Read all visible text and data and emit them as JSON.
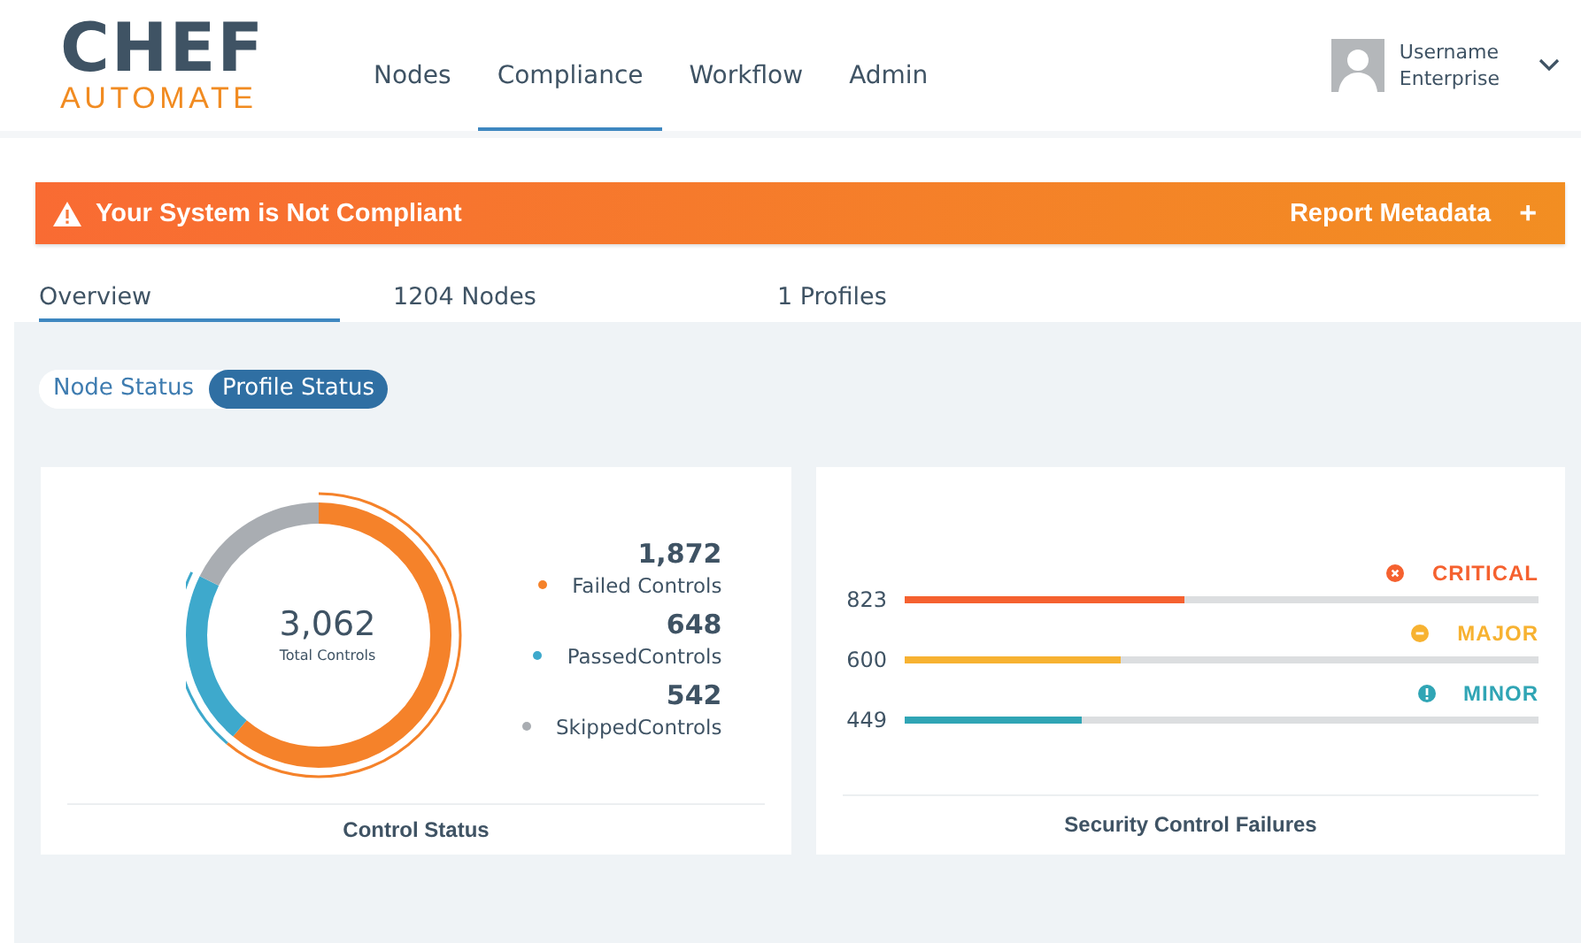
{
  "header": {
    "logo_top": "CHEF",
    "logo_bottom": "AUTOMATE",
    "nav": [
      {
        "label": "Nodes",
        "selected": false
      },
      {
        "label": "Compliance",
        "selected": true
      },
      {
        "label": "Workflow",
        "selected": false
      },
      {
        "label": "Admin",
        "selected": false
      }
    ],
    "user": {
      "name": "Username",
      "org": "Enterprise"
    }
  },
  "banner": {
    "message": "Your System is Not Compliant",
    "action": "Report Metadata",
    "action_icon": "+"
  },
  "tabs": [
    {
      "label": "Overview",
      "selected": true
    },
    {
      "label": "1204 Nodes",
      "selected": false
    },
    {
      "label": "1 Profiles",
      "selected": false
    }
  ],
  "status_toggle": [
    {
      "label": "Node Status",
      "selected": false
    },
    {
      "label": "Profile Status",
      "selected": true
    }
  ],
  "control_status": {
    "title": "Control Status",
    "total": "3,062",
    "total_label": "Total Controls",
    "legend": [
      {
        "value": "1,872",
        "label": "Failed Controls",
        "color": "#f5822a"
      },
      {
        "value": "648",
        "label": "PassedControls",
        "color": "#3ea9cc"
      },
      {
        "value": "542",
        "label": "SkippedControls",
        "color": "#a9adb2"
      }
    ]
  },
  "security_failures": {
    "title": "Security Control Failures",
    "rows": [
      {
        "count": "823",
        "severity": "CRITICAL",
        "kind": "critical",
        "color": "#f5612f",
        "level": 0.44
      },
      {
        "count": "600",
        "severity": "MAJOR",
        "kind": "major",
        "color": "#f7b231",
        "level": 0.34
      },
      {
        "count": "449",
        "severity": "MINOR",
        "kind": "minor",
        "color": "#30a5b5",
        "level": 0.28
      }
    ]
  }
}
